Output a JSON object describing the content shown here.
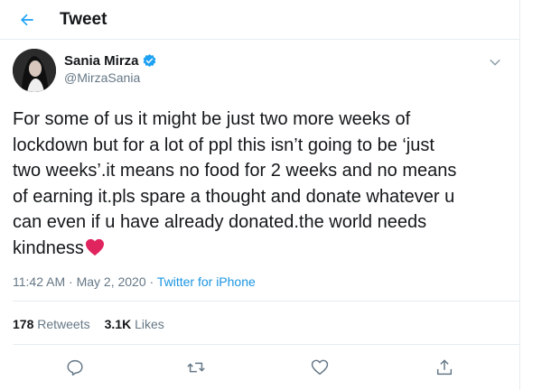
{
  "header": {
    "title": "Tweet",
    "back_icon": "back-arrow-icon"
  },
  "author": {
    "name": "Sania Mirza",
    "handle": "@MirzaSania",
    "verified_icon": "verified-badge-icon",
    "menu_icon": "chevron-down-icon"
  },
  "tweet": {
    "text": "For some of us it might be just two more weeks of\nlockdown but for a lot of ppl this isn’t going to be ‘just\ntwo weeks’.it means no food for 2 weeks and no means\nof earning it.pls spare a thought and donate whatever u\ncan even if u have already donated.the world needs\nkindness",
    "emoji": "red-heart-icon"
  },
  "meta": {
    "time": "11:42 AM",
    "separator1": " · ",
    "date": "May 2, 2020",
    "separator2": " · ",
    "source": "Twitter for iPhone"
  },
  "stats": {
    "retweets_count": "178",
    "retweets_label": "Retweets",
    "likes_count": "3.1K",
    "likes_label": "Likes"
  },
  "actions": [
    {
      "name": "reply-icon"
    },
    {
      "name": "retweet-icon"
    },
    {
      "name": "like-icon"
    },
    {
      "name": "share-icon"
    }
  ],
  "colors": {
    "accent": "#1da1f2",
    "link": "#1b95e0",
    "secondary_text": "#657786",
    "heart": "#e0245e"
  }
}
